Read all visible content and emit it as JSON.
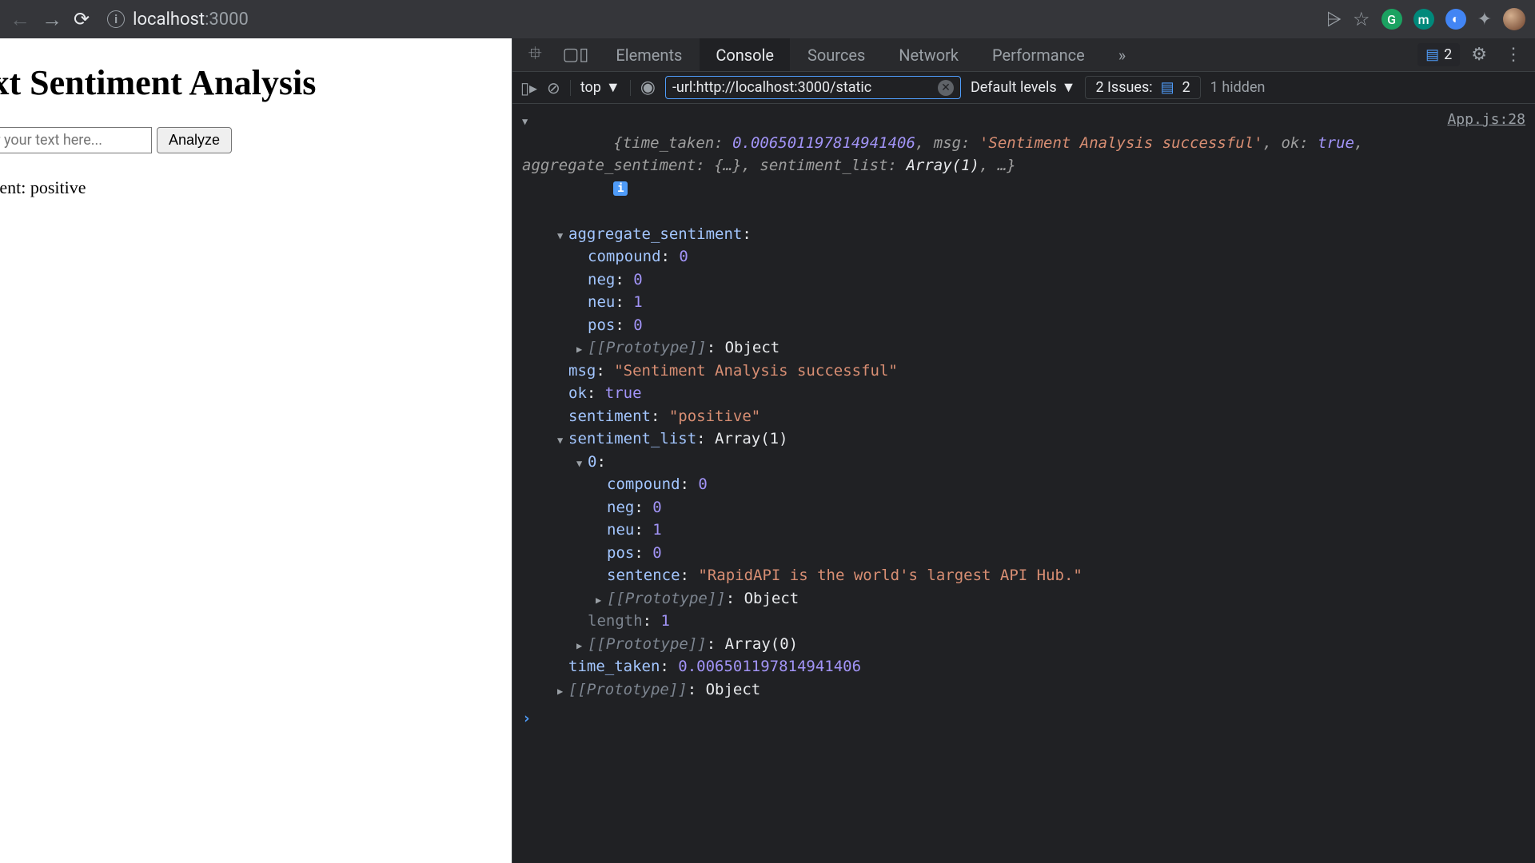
{
  "browser": {
    "url_host": "localhost",
    "url_port": ":3000",
    "translate_icon": "⩥",
    "star_icon": "☆"
  },
  "page": {
    "heading": "ext Sentiment Analysis",
    "input_placeholder": "ter your text here...",
    "analyze_label": "Analyze",
    "result": "timent: positive"
  },
  "devtools": {
    "tabs": [
      "Elements",
      "Console",
      "Sources",
      "Network",
      "Performance"
    ],
    "active_tab": "Console",
    "overflow": "»",
    "msg_count": "2",
    "toolbar": {
      "context": "top",
      "filter": "-url:http://localhost:3000/static",
      "levels": "Default levels",
      "issues_label": "2 Issues:",
      "issues_count": "2",
      "hidden": "1 hidden"
    },
    "source_link": "App.js:28",
    "summary_line_1": "{time_taken: ",
    "summary_time": "0.006501197814941406",
    "summary_line_2": ", msg: ",
    "summary_msg": "'Sentiment Analysis successful'",
    "summary_line_3": ", ok: ",
    "summary_ok": "true",
    "summary_line_4": ", aggregate_sentiment: {…}, sentiment_list: ",
    "summary_arr": "Array(1)",
    "summary_line_5": ", …}",
    "tree": {
      "agg_key": "aggregate_sentiment",
      "compound_k": "compound",
      "compound_v": "0",
      "neg_k": "neg",
      "neg_v": "0",
      "neu_k": "neu",
      "neu_v": "1",
      "pos_k": "pos",
      "pos_v": "0",
      "proto_k": "[[Prototype]]",
      "proto_obj": "Object",
      "msg_k": "msg",
      "msg_v": "\"Sentiment Analysis successful\"",
      "ok_k": "ok",
      "ok_v": "true",
      "sentiment_k": "sentiment",
      "sentiment_v": "\"positive\"",
      "slist_k": "sentiment_list",
      "slist_v": "Array(1)",
      "idx0": "0",
      "s_compound_v": "0",
      "s_neg_v": "0",
      "s_neu_v": "1",
      "s_pos_v": "0",
      "sentence_k": "sentence",
      "sentence_v": "\"RapidAPI is the world's largest API Hub.\"",
      "length_k": "length",
      "length_v": "1",
      "proto_arr": "Array(0)",
      "time_k": "time_taken",
      "time_v": "0.006501197814941406"
    }
  }
}
